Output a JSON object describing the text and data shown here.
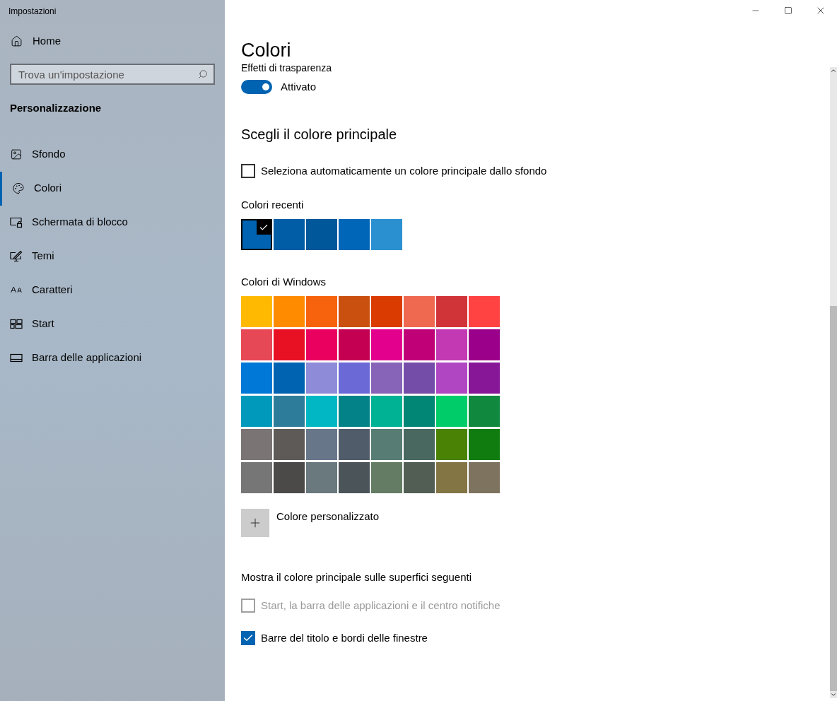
{
  "window": {
    "title": "Impostazioni"
  },
  "sidebar": {
    "home": "Home",
    "search": {
      "placeholder": "Trova un'impostazione"
    },
    "section": "Personalizzazione",
    "items": [
      {
        "label": "Sfondo",
        "kind": "image",
        "selected": false
      },
      {
        "label": "Colori",
        "kind": "palette",
        "selected": true
      },
      {
        "label": "Schermata di blocco",
        "kind": "lockscreen",
        "selected": false
      },
      {
        "label": "Temi",
        "kind": "themes",
        "selected": false
      },
      {
        "label": "Caratteri",
        "kind": "fonts",
        "selected": false
      },
      {
        "label": "Start",
        "kind": "start",
        "selected": false
      },
      {
        "label": "Barra delle applicazioni",
        "kind": "taskbar",
        "selected": false
      }
    ]
  },
  "page": {
    "title": "Colori",
    "transparency": {
      "label": "Effetti di trasparenza",
      "on": true,
      "state": "Attivato"
    },
    "accent_heading": "Scegli il colore principale",
    "auto_checkbox": {
      "label": "Seleziona automaticamente un colore principale dallo sfondo",
      "checked": false,
      "disabled": false
    },
    "recent": {
      "label": "Colori recenti",
      "colors": [
        {
          "color": "#0063b1",
          "selected": true
        },
        {
          "color": "#005da6",
          "selected": false
        },
        {
          "color": "#00579a",
          "selected": false
        },
        {
          "color": "#0067b8",
          "selected": false
        },
        {
          "color": "#2b90d0",
          "selected": false
        }
      ]
    },
    "windows_colors": {
      "label": "Colori di Windows",
      "rows": [
        [
          {
            "color": "#ffb900"
          },
          {
            "color": "#ff8c00"
          },
          {
            "color": "#f7630c"
          },
          {
            "color": "#ca5010"
          },
          {
            "color": "#da3b01"
          },
          {
            "color": "#ef6950"
          },
          {
            "color": "#d13438"
          },
          {
            "color": "#ff4343"
          }
        ],
        [
          {
            "color": "#e74856"
          },
          {
            "color": "#e81123"
          },
          {
            "color": "#ea005e"
          },
          {
            "color": "#c30052"
          },
          {
            "color": "#e3008c"
          },
          {
            "color": "#bf0077"
          },
          {
            "color": "#c239b3"
          },
          {
            "color": "#9a0089"
          }
        ],
        [
          {
            "color": "#0078d7"
          },
          {
            "color": "#0063b1"
          },
          {
            "color": "#8e8cd8"
          },
          {
            "color": "#6b69d6"
          },
          {
            "color": "#8764b8"
          },
          {
            "color": "#744da9"
          },
          {
            "color": "#b146c2"
          },
          {
            "color": "#881798"
          }
        ],
        [
          {
            "color": "#0099bc"
          },
          {
            "color": "#2d7d9a"
          },
          {
            "color": "#00b7c3"
          },
          {
            "color": "#038387"
          },
          {
            "color": "#00b294"
          },
          {
            "color": "#018574"
          },
          {
            "color": "#00cc6a"
          },
          {
            "color": "#10893e"
          }
        ],
        [
          {
            "color": "#7a7574"
          },
          {
            "color": "#5d5a58"
          },
          {
            "color": "#68768a"
          },
          {
            "color": "#515c6b"
          },
          {
            "color": "#567c73"
          },
          {
            "color": "#486860"
          },
          {
            "color": "#498205"
          },
          {
            "color": "#107c10"
          }
        ],
        [
          {
            "color": "#767676"
          },
          {
            "color": "#4c4a48"
          },
          {
            "color": "#69797e"
          },
          {
            "color": "#4a5459"
          },
          {
            "color": "#647c64"
          },
          {
            "color": "#525e54"
          },
          {
            "color": "#847545"
          },
          {
            "color": "#7e735f"
          }
        ]
      ]
    },
    "custom_color": "Colore personalizzato",
    "surfaces_heading": "Mostra il colore principale sulle superfici seguenti",
    "surfaces": [
      {
        "label": "Start, la barra delle applicazioni e il centro notifiche",
        "checked": false,
        "disabled": true
      },
      {
        "label": "Barre del titolo e bordi delle finestre",
        "checked": true,
        "disabled": false
      }
    ]
  }
}
